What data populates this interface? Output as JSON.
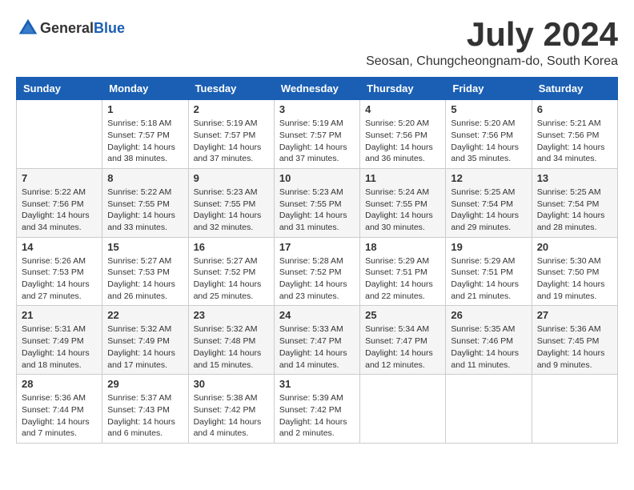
{
  "header": {
    "logo_general": "General",
    "logo_blue": "Blue",
    "month_title": "July 2024",
    "location": "Seosan, Chungcheongnam-do, South Korea"
  },
  "days_of_week": [
    "Sunday",
    "Monday",
    "Tuesday",
    "Wednesday",
    "Thursday",
    "Friday",
    "Saturday"
  ],
  "weeks": [
    [
      {
        "day": "",
        "info": ""
      },
      {
        "day": "1",
        "info": "Sunrise: 5:18 AM\nSunset: 7:57 PM\nDaylight: 14 hours\nand 38 minutes."
      },
      {
        "day": "2",
        "info": "Sunrise: 5:19 AM\nSunset: 7:57 PM\nDaylight: 14 hours\nand 37 minutes."
      },
      {
        "day": "3",
        "info": "Sunrise: 5:19 AM\nSunset: 7:57 PM\nDaylight: 14 hours\nand 37 minutes."
      },
      {
        "day": "4",
        "info": "Sunrise: 5:20 AM\nSunset: 7:56 PM\nDaylight: 14 hours\nand 36 minutes."
      },
      {
        "day": "5",
        "info": "Sunrise: 5:20 AM\nSunset: 7:56 PM\nDaylight: 14 hours\nand 35 minutes."
      },
      {
        "day": "6",
        "info": "Sunrise: 5:21 AM\nSunset: 7:56 PM\nDaylight: 14 hours\nand 34 minutes."
      }
    ],
    [
      {
        "day": "7",
        "info": "Sunrise: 5:22 AM\nSunset: 7:56 PM\nDaylight: 14 hours\nand 34 minutes."
      },
      {
        "day": "8",
        "info": "Sunrise: 5:22 AM\nSunset: 7:55 PM\nDaylight: 14 hours\nand 33 minutes."
      },
      {
        "day": "9",
        "info": "Sunrise: 5:23 AM\nSunset: 7:55 PM\nDaylight: 14 hours\nand 32 minutes."
      },
      {
        "day": "10",
        "info": "Sunrise: 5:23 AM\nSunset: 7:55 PM\nDaylight: 14 hours\nand 31 minutes."
      },
      {
        "day": "11",
        "info": "Sunrise: 5:24 AM\nSunset: 7:55 PM\nDaylight: 14 hours\nand 30 minutes."
      },
      {
        "day": "12",
        "info": "Sunrise: 5:25 AM\nSunset: 7:54 PM\nDaylight: 14 hours\nand 29 minutes."
      },
      {
        "day": "13",
        "info": "Sunrise: 5:25 AM\nSunset: 7:54 PM\nDaylight: 14 hours\nand 28 minutes."
      }
    ],
    [
      {
        "day": "14",
        "info": "Sunrise: 5:26 AM\nSunset: 7:53 PM\nDaylight: 14 hours\nand 27 minutes."
      },
      {
        "day": "15",
        "info": "Sunrise: 5:27 AM\nSunset: 7:53 PM\nDaylight: 14 hours\nand 26 minutes."
      },
      {
        "day": "16",
        "info": "Sunrise: 5:27 AM\nSunset: 7:52 PM\nDaylight: 14 hours\nand 25 minutes."
      },
      {
        "day": "17",
        "info": "Sunrise: 5:28 AM\nSunset: 7:52 PM\nDaylight: 14 hours\nand 23 minutes."
      },
      {
        "day": "18",
        "info": "Sunrise: 5:29 AM\nSunset: 7:51 PM\nDaylight: 14 hours\nand 22 minutes."
      },
      {
        "day": "19",
        "info": "Sunrise: 5:29 AM\nSunset: 7:51 PM\nDaylight: 14 hours\nand 21 minutes."
      },
      {
        "day": "20",
        "info": "Sunrise: 5:30 AM\nSunset: 7:50 PM\nDaylight: 14 hours\nand 19 minutes."
      }
    ],
    [
      {
        "day": "21",
        "info": "Sunrise: 5:31 AM\nSunset: 7:49 PM\nDaylight: 14 hours\nand 18 minutes."
      },
      {
        "day": "22",
        "info": "Sunrise: 5:32 AM\nSunset: 7:49 PM\nDaylight: 14 hours\nand 17 minutes."
      },
      {
        "day": "23",
        "info": "Sunrise: 5:32 AM\nSunset: 7:48 PM\nDaylight: 14 hours\nand 15 minutes."
      },
      {
        "day": "24",
        "info": "Sunrise: 5:33 AM\nSunset: 7:47 PM\nDaylight: 14 hours\nand 14 minutes."
      },
      {
        "day": "25",
        "info": "Sunrise: 5:34 AM\nSunset: 7:47 PM\nDaylight: 14 hours\nand 12 minutes."
      },
      {
        "day": "26",
        "info": "Sunrise: 5:35 AM\nSunset: 7:46 PM\nDaylight: 14 hours\nand 11 minutes."
      },
      {
        "day": "27",
        "info": "Sunrise: 5:36 AM\nSunset: 7:45 PM\nDaylight: 14 hours\nand 9 minutes."
      }
    ],
    [
      {
        "day": "28",
        "info": "Sunrise: 5:36 AM\nSunset: 7:44 PM\nDaylight: 14 hours\nand 7 minutes."
      },
      {
        "day": "29",
        "info": "Sunrise: 5:37 AM\nSunset: 7:43 PM\nDaylight: 14 hours\nand 6 minutes."
      },
      {
        "day": "30",
        "info": "Sunrise: 5:38 AM\nSunset: 7:42 PM\nDaylight: 14 hours\nand 4 minutes."
      },
      {
        "day": "31",
        "info": "Sunrise: 5:39 AM\nSunset: 7:42 PM\nDaylight: 14 hours\nand 2 minutes."
      },
      {
        "day": "",
        "info": ""
      },
      {
        "day": "",
        "info": ""
      },
      {
        "day": "",
        "info": ""
      }
    ]
  ]
}
